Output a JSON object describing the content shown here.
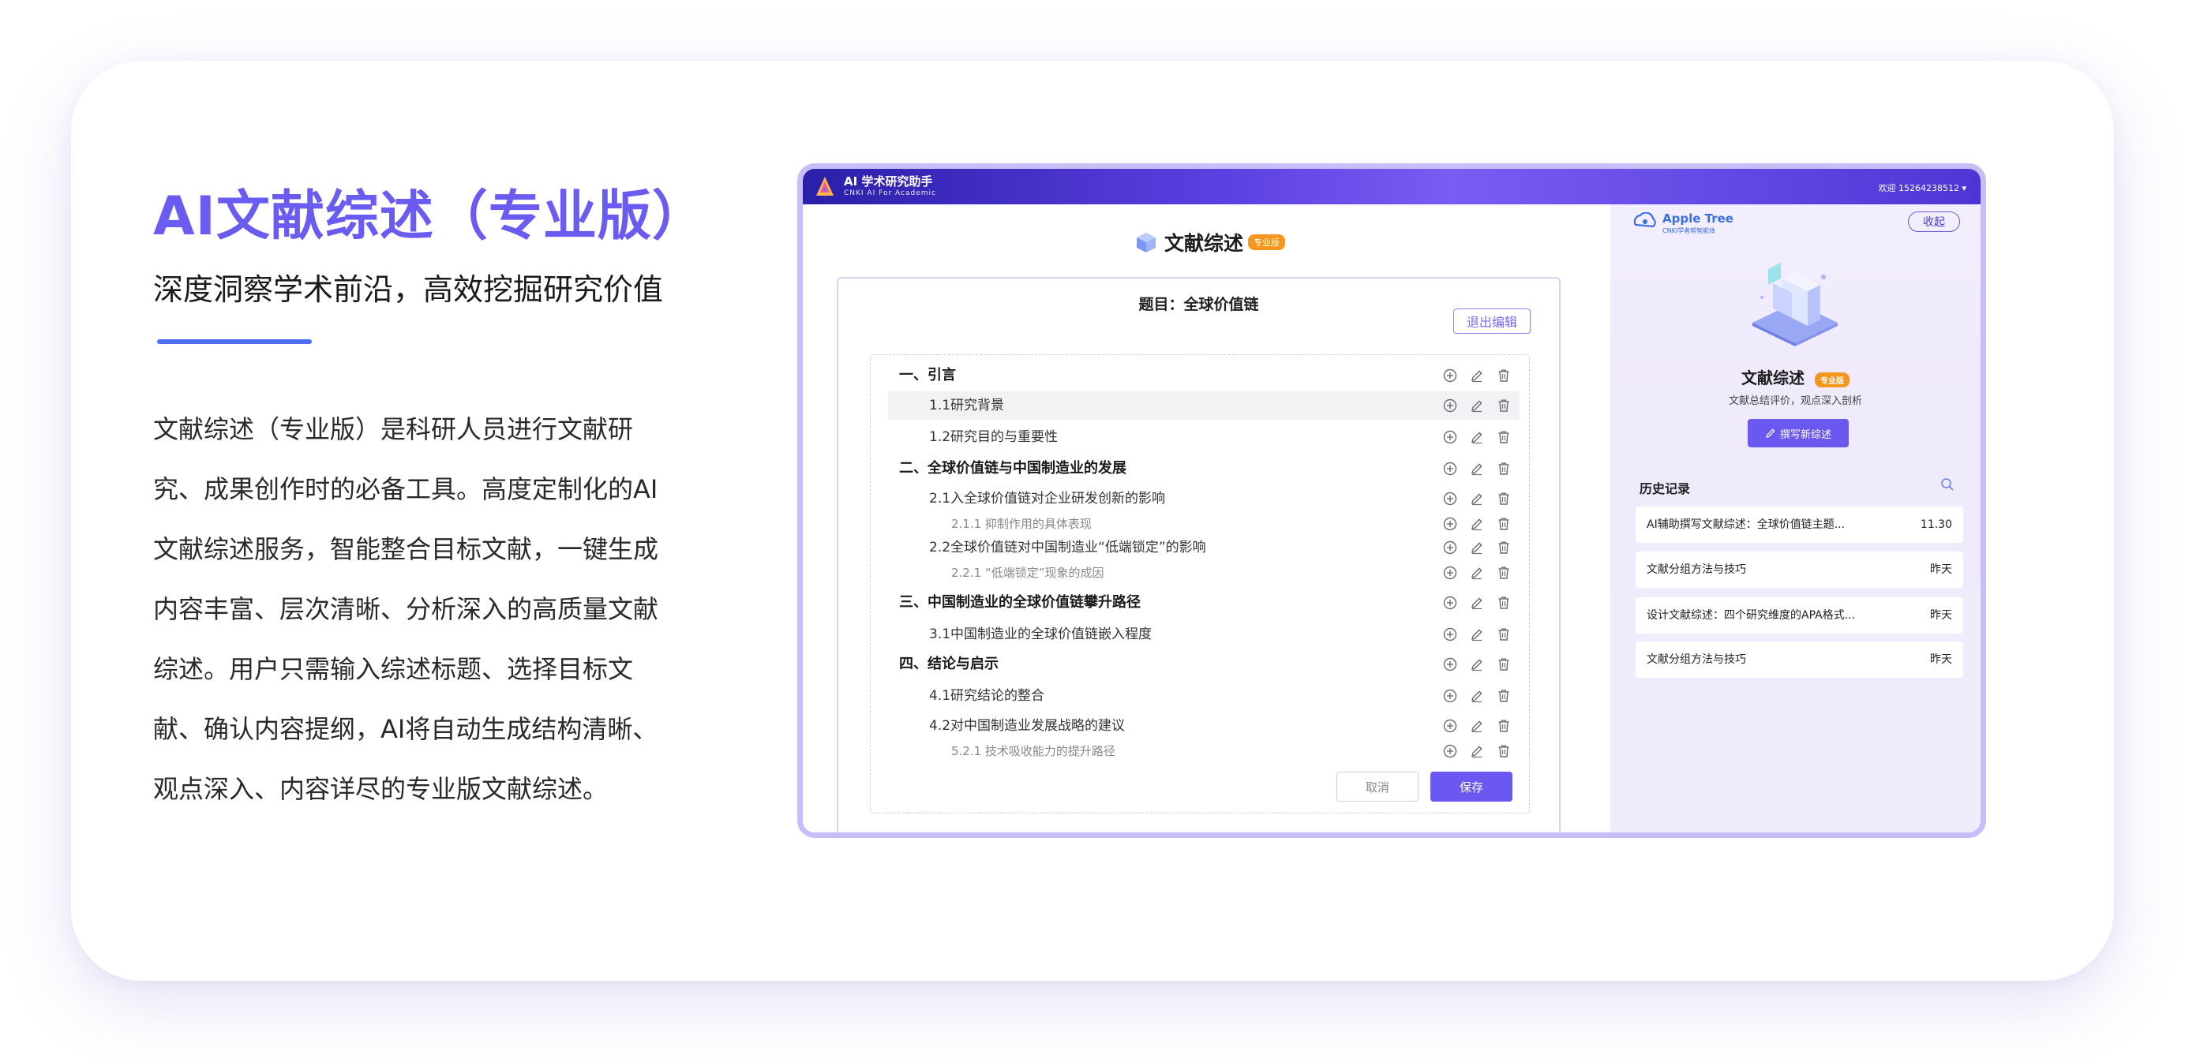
{
  "hero": {
    "title": "AI文献综述（专业版）",
    "subtitle": "深度洞察学术前沿，高效挖掘研究价值",
    "description_lines": [
      "文献综述（专业版）是科研人员进行文献研",
      "究、成果创作时的必备工具。高度定制化的AI",
      "文献综述服务，智能整合目标文献，一键生成",
      "内容丰富、层次清晰、分析深入的高质量文献",
      "综述。用户只需输入综述标题、选择目标文",
      "献、确认内容提纲，AI将自动生成结构清晰、",
      "观点深入、内容详尽的专业版文献综述。"
    ]
  },
  "app": {
    "brand_name": "AI 学术研究助手",
    "brand_sub": "CNKI AI For Academic",
    "user_greeting": "欢迎 15264238512 ▾",
    "page_title": "文献综述",
    "pro_badge": "专业版",
    "editor": {
      "topic": "题目：全球价值链",
      "exit_edit_label": "退出编辑",
      "outline": [
        {
          "level": 1,
          "label": "一、引言"
        },
        {
          "level": 2,
          "label": "1.1研究背景",
          "highlighted": true
        },
        {
          "level": 2,
          "label": "1.2研究目的与重要性"
        },
        {
          "level": 1,
          "label": "二、全球价值链与中国制造业的发展"
        },
        {
          "level": 2,
          "label": "2.1入全球价值链对企业研发创新的影响"
        },
        {
          "level": 3,
          "label": "2.1.1 抑制作用的具体表现"
        },
        {
          "level": 2,
          "label": "2.2全球价值链对中国制造业“低端锁定”的影响"
        },
        {
          "level": 3,
          "label": "2.2.1 “低端锁定”现象的成因"
        },
        {
          "level": 1,
          "label": "三、中国制造业的全球价值链攀升路径"
        },
        {
          "level": 2,
          "label": "3.1中国制造业的全球价值链嵌入程度"
        },
        {
          "level": 1,
          "label": "四、结论与启示"
        },
        {
          "level": 2,
          "label": "4.1研究结论的整合"
        },
        {
          "level": 2,
          "label": "4.2对中国制造业发展战略的建议"
        },
        {
          "level": 3,
          "label": "5.2.1 技术吸收能力的提升路径"
        }
      ],
      "cancel_label": "取消",
      "save_label": "保存"
    },
    "side": {
      "logo_name": "Apple Tree",
      "logo_sub": "CNKI学者帮智能体",
      "collapse_label": "收起",
      "title": "文献综述",
      "pro_badge": "专业版",
      "description": "文献总结评价，观点深入剖析",
      "write_button_label": "撰写新综述",
      "history_title": "历史记录",
      "history": [
        {
          "title": "AI辅助撰写文献综述：全球价值链主题...",
          "time": "11.30"
        },
        {
          "title": "文献分组方法与技巧",
          "time": "昨天"
        },
        {
          "title": "设计文献综述：四个研究维度的APA格式...",
          "time": "昨天"
        },
        {
          "title": "文献分组方法与技巧",
          "time": "昨天"
        }
      ]
    },
    "colors": {
      "accent": "#6b58f0",
      "title_purple": "#6a5cf0",
      "badge_orange": "#f7961e",
      "window_border": "#c7bdf8"
    }
  }
}
